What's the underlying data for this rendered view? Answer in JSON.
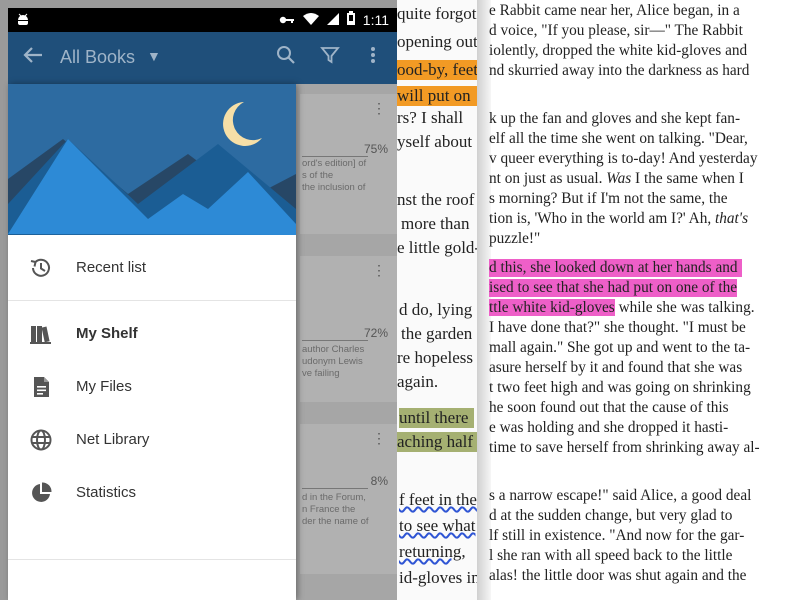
{
  "status_bar": {
    "time": "1:11"
  },
  "app_bar": {
    "title": "All Books"
  },
  "drawer": {
    "menu": [
      {
        "label": "Recent list",
        "icon": "history-icon"
      },
      {
        "label": "My Shelf",
        "icon": "bookshelf-icon",
        "active": true
      },
      {
        "label": "My Files",
        "icon": "file-icon"
      },
      {
        "label": "Net Library",
        "icon": "globe-icon"
      },
      {
        "label": "Statistics",
        "icon": "pie-chart-icon"
      }
    ]
  },
  "books": [
    {
      "progress": "75%",
      "desc": [
        "ord's edition] of",
        "s of the",
        "the inclusion of"
      ]
    },
    {
      "progress": "72%",
      "desc": [
        "author Charles",
        "udonym Lewis",
        "ve failing"
      ]
    },
    {
      "progress": "8%",
      "desc": [
        "d in the Forum,",
        "n France the",
        "der the name of"
      ]
    }
  ],
  "colors": {
    "app_bar": "#1f4f7a",
    "drawer_header": "#2d6ba1",
    "highlight_orange": "#f29a24",
    "highlight_pink": "#ee5fc8",
    "highlight_green": "#a5b072",
    "underline_blue": "#2f55d4"
  },
  "left_page": {
    "lines": [
      "quite forgot",
      "opening out",
      "ood-by, feet!",
      "will put on",
      "rs? I shall",
      "yself about",
      "nst the roof",
      "more than",
      "e little gold-",
      "d do, lying",
      "the garden",
      "re hopeless",
      "again.",
      "until there",
      "aching half",
      "f feet in the",
      "to see what",
      "returning,",
      "id-gloves in"
    ]
  },
  "right_page": {
    "p1": [
      "e Rabbit came near her, Alice began, in a",
      "d voice, \"If you please, sir—\" The Rabbit",
      "iolently, dropped the white kid-gloves and",
      "nd skurried away into the darkness as hard"
    ],
    "p2": [
      "k up the fan and gloves and she kept fan-",
      "elf all the time she went on talking. \"Dear,",
      "v queer everything is to-day! And yesterday"
    ],
    "p2_l4a": "nt on just as usual. ",
    "p2_l4_was": "Was",
    "p2_l4b": " I the same when I",
    "p2_l5": "s morning? But if I'm not the same, the",
    "p2_l6a": "tion is, 'Who in the world am I?' Ah, ",
    "p2_l6_thats": "that's",
    "p2_l7": "puzzle!\"",
    "p3_hl1": "d this, she looked down at her hands and",
    "p3_hl2": "ised to see that she had put on one of the",
    "p3_hl3": "ttle white kid-gloves",
    "p3_l3_rest": " while she was talking.",
    "p3": [
      "I have done that?\" she thought. \"I must be",
      "mall again.\" She got up and went to the ta-",
      "asure herself by it and found that she was",
      "t two feet high and was going on shrinking",
      "he soon found out that the cause of this",
      "e was holding and she dropped it hasti-",
      "time to save herself from shrinking away al-"
    ],
    "p4": [
      "s a narrow escape!\" said Alice, a good deal",
      "d at the sudden change, but very glad to",
      "lf still in existence. \"And now for the gar-",
      "l she ran with all speed back to the little",
      "alas! the little door was shut again and the"
    ]
  }
}
